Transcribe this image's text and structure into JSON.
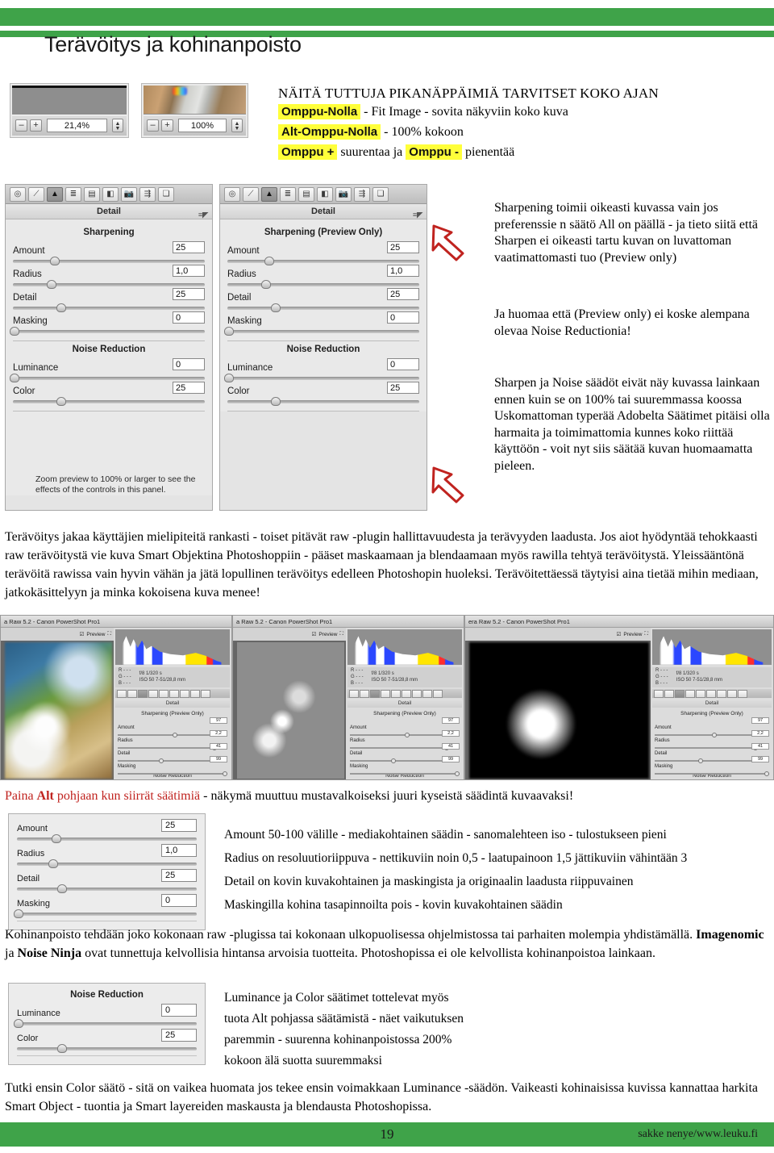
{
  "theme": {
    "green": "#3fa349",
    "highlight": "#ffff3a",
    "red": "#c0231f"
  },
  "header": {
    "title": "Terävöitys ja kohinanpoisto"
  },
  "zoom_widgets": [
    {
      "name": "fit-image-zoom",
      "value": "21,4%",
      "minus": "–",
      "plus": "+"
    },
    {
      "name": "hundred-percent-zoom",
      "value": "100%",
      "minus": "–",
      "plus": "+"
    }
  ],
  "shortcuts": {
    "heading": "NÄITÄ TUTTUJA PIKANÄPPÄIMIÄ TARVITSET KOKO AJAN",
    "lines": [
      {
        "key": "Omppu-Nolla",
        "desc": "-  Fit Image - sovita näkyviin koko kuva"
      },
      {
        "key": "Alt-Omppu-Nolla",
        "desc": "- 100% kokoon"
      },
      {
        "key": "Omppu +",
        "desc": "suurentaa ja",
        "key2": "Omppu -",
        "desc2": "pienentää"
      }
    ]
  },
  "detail_panel_left": {
    "panel_title": "Detail",
    "sharpening_label": "Sharpening",
    "noise_label": "Noise Reduction",
    "sliders": [
      {
        "label": "Amount",
        "value": "25",
        "pos": 22
      },
      {
        "label": "Radius",
        "value": "1,0",
        "pos": 20
      },
      {
        "label": "Detail",
        "value": "25",
        "pos": 25
      },
      {
        "label": "Masking",
        "value": "0",
        "pos": 1
      }
    ],
    "noise_sliders": [
      {
        "label": "Luminance",
        "value": "0",
        "pos": 1
      },
      {
        "label": "Color",
        "value": "25",
        "pos": 25
      }
    ],
    "note": "Zoom preview to 100% or larger to see the effects of the controls in this panel."
  },
  "detail_panel_right": {
    "panel_title": "Detail",
    "sharpening_label": "Sharpening  (Preview Only)",
    "noise_label": "Noise Reduction",
    "sliders": [
      {
        "label": "Amount",
        "value": "25",
        "pos": 22
      },
      {
        "label": "Radius",
        "value": "1,0",
        "pos": 20
      },
      {
        "label": "Detail",
        "value": "25",
        "pos": 25
      },
      {
        "label": "Masking",
        "value": "0",
        "pos": 1
      }
    ],
    "noise_sliders": [
      {
        "label": "Luminance",
        "value": "0",
        "pos": 1
      },
      {
        "label": "Color",
        "value": "25",
        "pos": 25
      }
    ]
  },
  "side_notes": {
    "block1": "Sharpening toimii oikeasti kuvassa vain jos preferenssie n säätö All on päällä - ja tieto siitä että Sharpen ei oikeasti tartu kuvan on luvattoman vaatimattomasti tuo (Preview only)",
    "block2": "Ja huomaa että (Preview only) ei koske alempana olevaa Noise Reductionia!",
    "block3": "Sharpen ja Noise säädöt eivät näy kuvassa lainkaan ennen kuin se on 100% tai suuremmassa koossa Uskomattoman typerää Adobelta Säätimet pitäisi olla harmaita ja toimimattomia kunnes koko riittää käyttöön - voit nyt siis säätää kuvan huomaamatta pieleen."
  },
  "paragraph1": "Terävöitys jakaa käyttäjien mielipiteitä rankasti - toiset pitävät raw -plugin hallittavuudesta ja terävyyden laadusta. Jos aiot hyödyntää tehokkaasti raw terävöitystä vie kuva Smart Objektina Photoshoppiin - pääset maskaamaan ja blendaamaan myös rawilla tehtyä terävöitystä. Yleissääntönä terävöitä rawissa vain hyvin vähän ja jätä lopullinen terävöitys edelleen Photoshopin huoleksi. Terävöitettäessä täytyisi aina tietää mihin mediaan, jatkokäsittelyyn ja minka kokoisena kuva menee!",
  "thumbnails": [
    {
      "title": "a Raw 5.2  -  Canon PowerShot Pro1",
      "preview_label": "Preview",
      "image_kind": "color-macro",
      "exif_rows": [
        "R  - - -",
        "G  - - -",
        "B  - - -"
      ],
      "exif_values": [
        "f/8   1/320 s",
        "ISO 50   7-51/28,8 mm"
      ],
      "panel_title": "Detail",
      "section": "Sharpening  (Preview Only)",
      "noise_section": "Noise Reduction",
      "sliders": [
        {
          "label": "Amount",
          "value": "97",
          "pos": 52
        },
        {
          "label": "Radius",
          "value": "2,2",
          "pos": 88
        },
        {
          "label": "Detail",
          "value": "41",
          "pos": 40
        },
        {
          "label": "Masking",
          "value": "99",
          "pos": 98
        }
      ]
    },
    {
      "title": "a Raw 5.2  -  Canon PowerShot Pro1",
      "preview_label": "Preview",
      "image_kind": "gray-mask",
      "exif_rows": [
        "R  - - -",
        "G  - - -",
        "B  - - -"
      ],
      "exif_values": [
        "f/8   1/320 s",
        "ISO 50   7-51/28,8 mm"
      ],
      "panel_title": "Detail",
      "section": "Sharpening  (Preview Only)",
      "noise_section": "Noise Reduction",
      "sliders": [
        {
          "label": "Amount",
          "value": "97",
          "pos": 52
        },
        {
          "label": "Radius",
          "value": "2,2",
          "pos": 88
        },
        {
          "label": "Detail",
          "value": "41",
          "pos": 40
        },
        {
          "label": "Masking",
          "value": "99",
          "pos": 98
        }
      ]
    },
    {
      "title": "era Raw 5.2  -  Canon PowerShot Pro1",
      "preview_label": "Preview",
      "image_kind": "bw-mask",
      "exif_rows": [
        "R  - - -",
        "G  - - -",
        "B  - - -"
      ],
      "exif_values": [
        "f/8   1/320 s",
        "ISO 50   7-51/28,8 mm"
      ],
      "panel_title": "Detail",
      "section": "Sharpening  (Preview Only)",
      "noise_section": "Noise Reduction",
      "sliders": [
        {
          "label": "Amount",
          "value": "97",
          "pos": 52
        },
        {
          "label": "Radius",
          "value": "2,2",
          "pos": 88
        },
        {
          "label": "Detail",
          "value": "41",
          "pos": 40
        },
        {
          "label": "Masking",
          "value": "99",
          "pos": 98
        }
      ]
    }
  ],
  "alt_line": {
    "red_part_1": "Paina ",
    "red_bold": "Alt",
    "red_part_2": " pohjaan kun siirrät säätimiä",
    "black_part": " - näkymä muuttuu mustavalkoiseksi juuri kyseistä säädintä kuvaavaksi!"
  },
  "sharpening_small_panel": {
    "sliders": [
      {
        "label": "Amount",
        "value": "25",
        "pos": 22
      },
      {
        "label": "Radius",
        "value": "1,0",
        "pos": 20
      },
      {
        "label": "Detail",
        "value": "25",
        "pos": 25
      },
      {
        "label": "Masking",
        "value": "0",
        "pos": 1
      }
    ]
  },
  "sharpening_tips": [
    "Amount 50-100 välille - mediakohtainen säädin - sanomalehteen iso - tulostukseen pieni",
    "Radius on resoluutioriippuva - nettikuviin noin 0,5 - laatupainoon 1,5 jättikuviin vähintään 3",
    "Detail on kovin kuvakohtainen ja maskingista ja originaalin laadusta riippuvainen",
    "Maskingilla kohina tasapinnoilta pois - kovin kuvakohtainen säädin"
  ],
  "paragraph2": {
    "part1": "Kohinanpoisto tehdään joko kokonaan raw -plugissa tai kokonaan ulkopuolisessa ohjelmistossa tai parhaiten molempia yhdistämällä. ",
    "bold1": "Imagenomic",
    "part2": " ja ",
    "bold2": "Noise Ninja",
    "part3": " ovat tunnettuja kelvollisia hintansa arvoisia tuotteita. Photoshopissa ei ole kelvollista kohinanpoistoa lainkaan."
  },
  "noise_small_panel": {
    "section": "Noise Reduction",
    "sliders": [
      {
        "label": "Luminance",
        "value": "0",
        "pos": 1
      },
      {
        "label": "Color",
        "value": "25",
        "pos": 25
      }
    ]
  },
  "noise_tips": [
    "Luminance ja Color säätimet tottelevat myös",
    "tuota Alt pohjassa säätämistä - näet vaikutuksen",
    "paremmin - suurenna kohinanpoistossa 200%",
    "kokoon älä suotta suuremmaksi"
  ],
  "paragraph3": "Tutki ensin Color säätö - sitä on vaikea huomata jos tekee ensin voimakkaan Luminance -säädön. Vaikeasti kohinaisissa kuvissa kannattaa harkita Smart Object - tuontia ja Smart layereiden maskausta ja blendausta Photoshopissa.",
  "footer": {
    "page_number": "19",
    "credit": "sakke nenye/www.leuku.fi"
  }
}
